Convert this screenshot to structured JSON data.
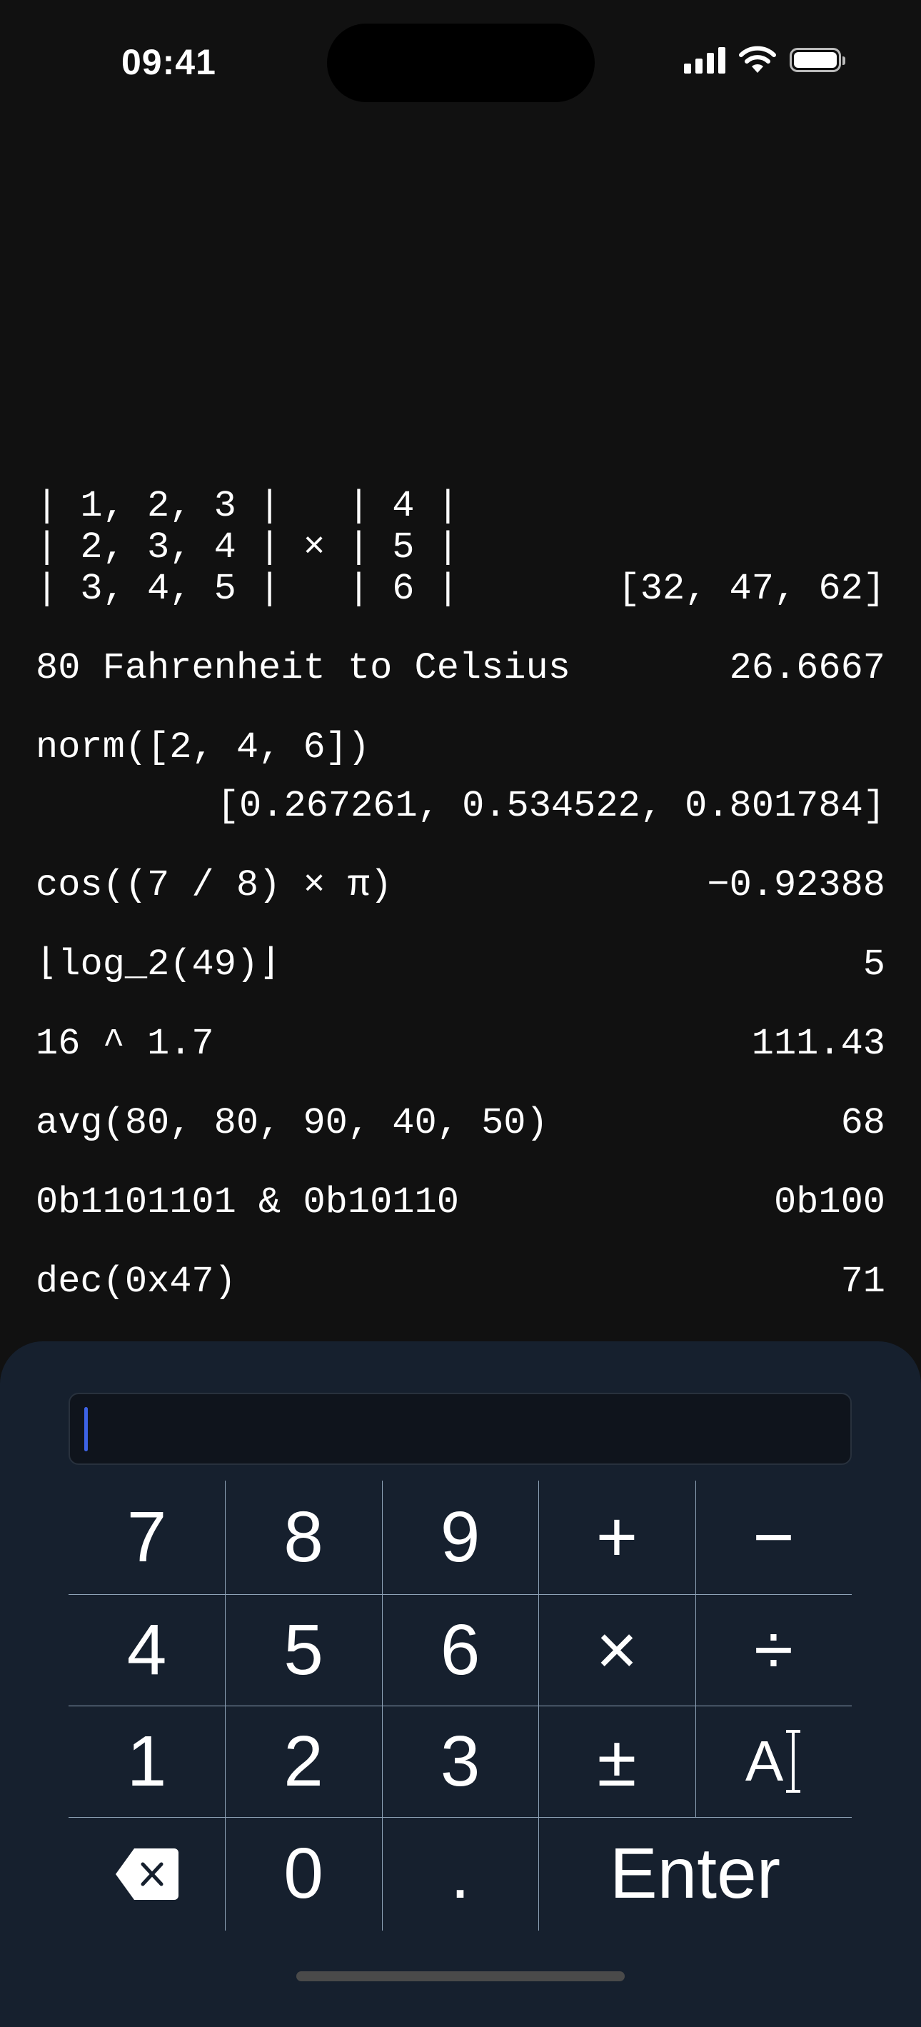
{
  "status_bar": {
    "time": "09:41",
    "signal_icon": "cellular-signal-icon",
    "wifi_icon": "wifi-icon",
    "battery_icon": "battery-icon"
  },
  "history": [
    {
      "expression": "| 1, 2, 3 |   | 4 |\n| 2, 3, 4 | × | 5 |\n| 3, 4, 5 |   | 6 |",
      "result": "[32, 47, 62]"
    },
    {
      "expression": "80 Fahrenheit to Celsius",
      "result": "26.6667"
    },
    {
      "expression": "norm([2, 4, 6])",
      "result": "[0.267261, 0.534522, 0.801784]"
    },
    {
      "expression": "cos((7 / 8) × π)",
      "result": "−0.92388"
    },
    {
      "expression": "⌊log_2(49)⌋",
      "result": "5"
    },
    {
      "expression": "16 ^ 1.7",
      "result": "111.43"
    },
    {
      "expression": "avg(80, 80, 90, 40, 50)",
      "result": "68"
    },
    {
      "expression": "0b1101101 & 0b10110",
      "result": "0b100"
    },
    {
      "expression": "dec(0x47)",
      "result": "71"
    }
  ],
  "input": {
    "value": ""
  },
  "keypad": {
    "k7": "7",
    "k8": "8",
    "k9": "9",
    "plus": "+",
    "minus": "−",
    "k4": "4",
    "k5": "5",
    "k6": "6",
    "times": "×",
    "divide": "÷",
    "k1": "1",
    "k2": "2",
    "k3": "3",
    "plusminus": "±",
    "text_mode": "A",
    "k0": "0",
    "dot": ".",
    "enter": "Enter"
  },
  "colors": {
    "background": "#111111",
    "panel": "#16202e",
    "caret": "#3d63e6"
  }
}
